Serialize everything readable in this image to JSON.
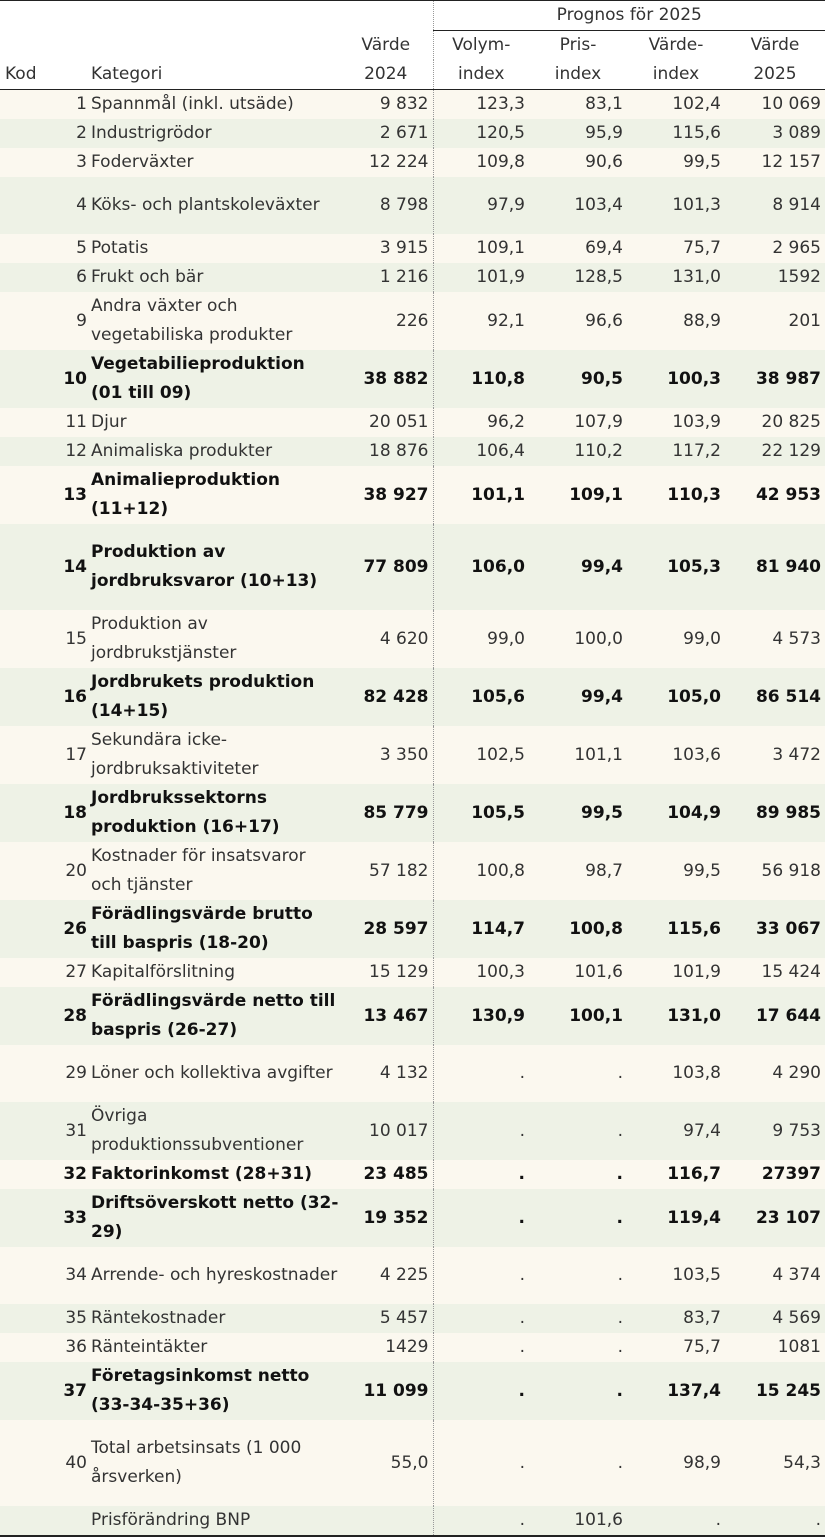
{
  "header": {
    "prognos": "Prognos för 2025",
    "kod": "Kod",
    "kategori": "Kategori",
    "varde2024_a": "Värde",
    "varde2024_b": "2024",
    "volym_a": "Volym-",
    "volym_b": "index",
    "pris_a": "Pris-",
    "pris_b": "index",
    "vardeindex_a": "Värde-",
    "vardeindex_b": "index",
    "varde2025_a": "Värde",
    "varde2025_b": "2025"
  },
  "rows": [
    {
      "kod": "1",
      "kategori": "Spannmål (inkl. utsäde)",
      "v2024": "9 832",
      "volym": "123,3",
      "pris": "83,1",
      "vindex": "102,4",
      "v2025": "10 069"
    },
    {
      "kod": "2",
      "kategori": "Industrigrödor",
      "v2024": "2 671",
      "volym": "120,5",
      "pris": "95,9",
      "vindex": "115,6",
      "v2025": "3 089"
    },
    {
      "kod": "3",
      "kategori": "Foderväxter",
      "v2024": "12 224",
      "volym": "109,8",
      "pris": "90,6",
      "vindex": "99,5",
      "v2025": "12 157"
    },
    {
      "kod": "4",
      "kategori": "Köks- och plantskoleväxter",
      "v2024": "8 798",
      "volym": "97,9",
      "pris": "103,4",
      "vindex": "101,3",
      "v2025": "8 914"
    },
    {
      "kod": "5",
      "kategori": "Potatis",
      "v2024": "3 915",
      "volym": "109,1",
      "pris": "69,4",
      "vindex": "75,7",
      "v2025": "2 965"
    },
    {
      "kod": "6",
      "kategori": "Frukt och bär",
      "v2024": "1 216",
      "volym": "101,9",
      "pris": "128,5",
      "vindex": "131,0",
      "v2025": "1592"
    },
    {
      "kod": "9",
      "kategori": "Andra växter och vegetabiliska produkter",
      "v2024": "226",
      "volym": "92,1",
      "pris": "96,6",
      "vindex": "88,9",
      "v2025": "201"
    },
    {
      "kod": "10",
      "kategori": "Vegetabilieproduktion (01 till 09)",
      "v2024": "38 882",
      "volym": "110,8",
      "pris": "90,5",
      "vindex": "100,3",
      "v2025": "38 987"
    },
    {
      "kod": "11",
      "kategori": "Djur",
      "v2024": "20 051",
      "volym": "96,2",
      "pris": "107,9",
      "vindex": "103,9",
      "v2025": "20 825"
    },
    {
      "kod": "12",
      "kategori": "Animaliska produkter",
      "v2024": "18 876",
      "volym": "106,4",
      "pris": "110,2",
      "vindex": "117,2",
      "v2025": "22 129"
    },
    {
      "kod": "13",
      "kategori": "Animalieproduktion (11+12)",
      "v2024": "38 927",
      "volym": "101,1",
      "pris": "109,1",
      "vindex": "110,3",
      "v2025": "42 953"
    },
    {
      "kod": "14",
      "kategori": "Produktion av jordbruksvaror (10+13)",
      "v2024": "77 809",
      "volym": "106,0",
      "pris": "99,4",
      "vindex": "105,3",
      "v2025": "81 940"
    },
    {
      "kod": "15",
      "kategori": "Produktion av jordbrukstjänster",
      "v2024": "4 620",
      "volym": "99,0",
      "pris": "100,0",
      "vindex": "99,0",
      "v2025": "4 573"
    },
    {
      "kod": "16",
      "kategori": "Jordbrukets produktion (14+15)",
      "v2024": "82 428",
      "volym": "105,6",
      "pris": "99,4",
      "vindex": "105,0",
      "v2025": "86 514"
    },
    {
      "kod": "17",
      "kategori": "Sekundära icke-jordbruksaktiviteter",
      "v2024": "3 350",
      "volym": "102,5",
      "pris": "101,1",
      "vindex": "103,6",
      "v2025": "3 472"
    },
    {
      "kod": "18",
      "kategori": "Jordbrukssektorns produktion (16+17)",
      "v2024": "85 779",
      "volym": "105,5",
      "pris": "99,5",
      "vindex": "104,9",
      "v2025": "89 985"
    },
    {
      "kod": "20",
      "kategori": "Kostnader för insatsvaror och tjänster",
      "v2024": "57 182",
      "volym": "100,8",
      "pris": "98,7",
      "vindex": "99,5",
      "v2025": "56 918"
    },
    {
      "kod": "26",
      "kategori": "Förädlingsvärde brutto till baspris (18-20)",
      "v2024": "28 597",
      "volym": "114,7",
      "pris": "100,8",
      "vindex": "115,6",
      "v2025": "33 067"
    },
    {
      "kod": "27",
      "kategori": "Kapitalförslitning",
      "v2024": "15 129",
      "volym": "100,3",
      "pris": "101,6",
      "vindex": "101,9",
      "v2025": "15 424"
    },
    {
      "kod": "28",
      "kategori": "Förädlingsvärde netto till baspris (26-27)",
      "v2024": "13 467",
      "volym": "130,9",
      "pris": "100,1",
      "vindex": "131,0",
      "v2025": "17 644"
    },
    {
      "kod": "29",
      "kategori": "Löner och kollektiva avgifter",
      "v2024": "4 132",
      "volym": ".",
      "pris": ".",
      "vindex": "103,8",
      "v2025": "4 290"
    },
    {
      "kod": "31",
      "kategori": "Övriga produktionssubventioner",
      "v2024": "10 017",
      "volym": ".",
      "pris": ".",
      "vindex": "97,4",
      "v2025": "9 753"
    },
    {
      "kod": "32",
      "kategori": "Faktorinkomst (28+31)",
      "v2024": "23 485",
      "volym": ".",
      "pris": ".",
      "vindex": "116,7",
      "v2025": "27397"
    },
    {
      "kod": "33",
      "kategori": "Driftsöverskott netto (32-29)",
      "v2024": "19 352",
      "volym": ".",
      "pris": ".",
      "vindex": "119,4",
      "v2025": "23 107"
    },
    {
      "kod": "34",
      "kategori": "Arrende- och hyreskostnader",
      "v2024": "4 225",
      "volym": ".",
      "pris": ".",
      "vindex": "103,5",
      "v2025": "4 374"
    },
    {
      "kod": "35",
      "kategori": "Räntekostnader",
      "v2024": "5 457",
      "volym": ".",
      "pris": ".",
      "vindex": "83,7",
      "v2025": "4 569"
    },
    {
      "kod": "36",
      "kategori": "Ränteintäkter",
      "v2024": "1429",
      "volym": ".",
      "pris": ".",
      "vindex": "75,7",
      "v2025": "1081"
    },
    {
      "kod": "37",
      "kategori": "Företagsinkomst netto (33-34-35+36)",
      "v2024": "11 099",
      "volym": ".",
      "pris": ".",
      "vindex": "137,4",
      "v2025": "15 245"
    },
    {
      "kod": "40",
      "kategori": "Total arbetsinsats (1 000 årsverken)",
      "v2024": "55,0",
      "volym": ".",
      "pris": ".",
      "vindex": "98,9",
      "v2025": "54,3"
    },
    {
      "kod": "",
      "kategori": "Prisförändring BNP",
      "v2024": "",
      "volym": ".",
      "pris": "101,6",
      "vindex": ".",
      "v2025": "."
    }
  ]
}
